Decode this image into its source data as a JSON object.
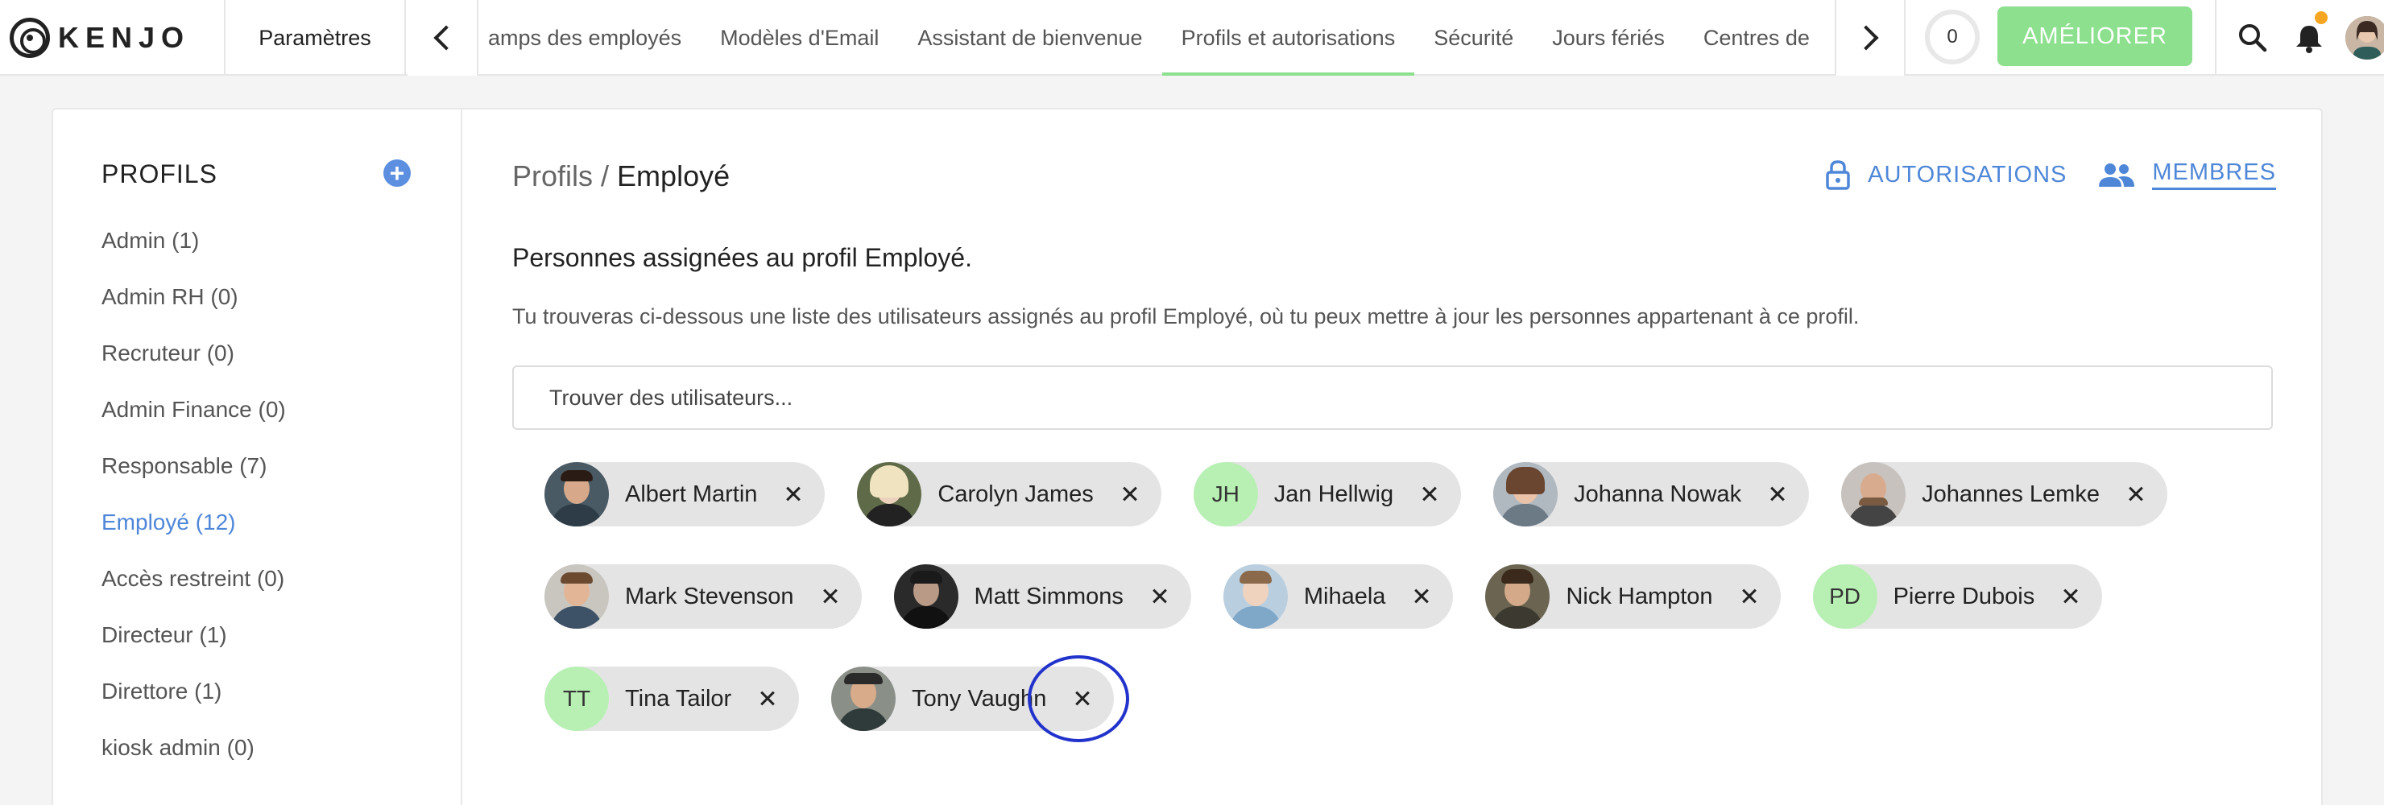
{
  "brand": {
    "name": "KENJO"
  },
  "topnav": {
    "settings_label": "Paramètres",
    "tabs": [
      "amps des employés",
      "Modèles d'Email",
      "Assistant de bienvenue",
      "Profils et autorisations",
      "Sécurité",
      "Jours fériés",
      "Centres de"
    ],
    "active_tab": "Profils et autorisations",
    "counter": "0",
    "upgrade_label": "AMÉLIORER"
  },
  "sidebar": {
    "title": "PROFILS",
    "items": [
      {
        "label": "Admin (1)"
      },
      {
        "label": "Admin RH (0)"
      },
      {
        "label": "Recruteur (0)"
      },
      {
        "label": "Admin Finance (0)"
      },
      {
        "label": "Responsable (7)"
      },
      {
        "label": "Employé (12)",
        "active": true
      },
      {
        "label": "Accès restreint (0)"
      },
      {
        "label": "Directeur (1)"
      },
      {
        "label": "Direttore (1)"
      },
      {
        "label": "kiosk admin (0)"
      }
    ]
  },
  "main": {
    "breadcrumb_parent": "Profils /",
    "breadcrumb_current": "Employé",
    "actions": {
      "permissions": "AUTORISATIONS",
      "members": "MEMBRES"
    },
    "section_title": "Personnes assignées au profil Employé.",
    "section_desc": "Tu trouveras ci-dessous une liste des utilisateurs assignés au profil Employé, où tu peux mettre à jour les personnes appartenant à ce profil.",
    "search_placeholder": "Trouver des utilisateurs...",
    "members": [
      {
        "name": "Albert Martin"
      },
      {
        "name": "Carolyn James"
      },
      {
        "name": "Jan Hellwig",
        "initials": "JH"
      },
      {
        "name": "Johanna Nowak"
      },
      {
        "name": "Johannes Lemke"
      },
      {
        "name": "Mark Stevenson"
      },
      {
        "name": "Matt Simmons"
      },
      {
        "name": "Mihaela"
      },
      {
        "name": "Nick Hampton"
      },
      {
        "name": "Pierre Dubois",
        "initials": "PD"
      },
      {
        "name": "Tina Tailor",
        "initials": "TT"
      },
      {
        "name": "Tony Vaughn"
      }
    ]
  },
  "colors": {
    "accent": "#4f87d8",
    "upgrade": "#8ce08e",
    "initials_bg": "#b8f0b4",
    "chip_bg": "#e4e4e4",
    "highlight": "#2233cc"
  }
}
